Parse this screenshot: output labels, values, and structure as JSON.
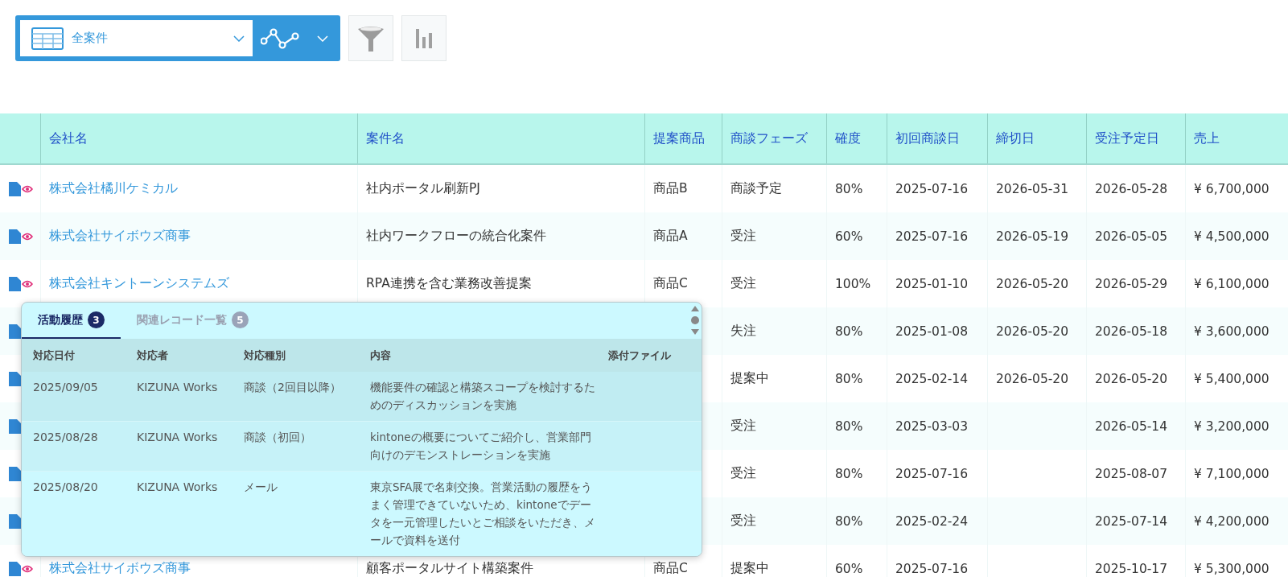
{
  "toolbar": {
    "view_name": "全案件"
  },
  "table": {
    "columns": [
      "会社名",
      "案件名",
      "提案商品",
      "商談フェーズ",
      "確度",
      "初回商談日",
      "締切日",
      "受注予定日",
      "売上"
    ],
    "rows": [
      {
        "company": "株式会社橘川ケミカル",
        "deal": "社内ポータル刷新PJ",
        "product": "商品B",
        "phase": "商談予定",
        "probability": "80%",
        "first_meeting": "2025-07-16",
        "deadline": "2026-05-31",
        "order_date": "2026-05-28",
        "sales": "¥ 6,700,000"
      },
      {
        "company": "株式会社サイボウズ商事",
        "deal": "社内ワークフローの統合化案件",
        "product": "商品A",
        "phase": "受注",
        "probability": "60%",
        "first_meeting": "2025-07-16",
        "deadline": "2026-05-19",
        "order_date": "2026-05-05",
        "sales": "¥ 4,500,000"
      },
      {
        "company": "株式会社キントーンシステムズ",
        "deal": "RPA連携を含む業務改善提案",
        "product": "商品C",
        "phase": "受注",
        "probability": "100%",
        "first_meeting": "2025-01-10",
        "deadline": "2026-05-20",
        "order_date": "2026-05-29",
        "sales": "¥ 6,100,000"
      },
      {
        "phase": "失注",
        "probability": "80%",
        "first_meeting": "2025-01-08",
        "deadline": "2026-05-20",
        "order_date": "2026-05-18",
        "sales": "¥ 3,600,000"
      },
      {
        "phase": "提案中",
        "probability": "80%",
        "first_meeting": "2025-02-14",
        "deadline": "2026-05-20",
        "order_date": "2026-05-20",
        "sales": "¥ 5,400,000"
      },
      {
        "phase": "受注",
        "probability": "80%",
        "first_meeting": "2025-03-03",
        "order_date": "2026-05-14",
        "sales": "¥ 3,200,000"
      },
      {
        "phase": "受注",
        "probability": "80%",
        "first_meeting": "2025-07-16",
        "order_date": "2025-08-07",
        "sales": "¥ 7,100,000"
      },
      {
        "phase": "受注",
        "probability": "80%",
        "first_meeting": "2025-02-24",
        "order_date": "2025-07-14",
        "sales": "¥ 4,200,000"
      },
      {
        "company": "株式会社サイボウズ商事",
        "deal": "顧客ポータルサイト構築案件",
        "product": "商品C",
        "phase": "提案中",
        "probability": "60%",
        "first_meeting": "2025-07-16",
        "order_date": "2025-10-17",
        "sales": "¥ 5,300,000"
      }
    ]
  },
  "popup": {
    "tabs": [
      {
        "label": "活動履歴",
        "count": "3",
        "selected": true
      },
      {
        "label": "関連レコード一覧",
        "count": "5",
        "selected": false
      }
    ],
    "columns": [
      "対応日付",
      "対応者",
      "対応種別",
      "内容",
      "添付ファイル"
    ],
    "rows": [
      {
        "date": "2025/09/05",
        "person": "KIZUNA Works",
        "type": "商談（2回目以降）",
        "content": "機能要件の確認と構築スコープを検討するためのディスカッションを実施"
      },
      {
        "date": "2025/08/28",
        "person": "KIZUNA Works",
        "type": "商談（初回）",
        "content": "kintoneの概要についてご紹介し、営業部門向けのデモンストレーションを実施"
      },
      {
        "date": "2025/08/20",
        "person": "KIZUNA Works",
        "type": "メール",
        "content": "東京SFA展で名刺交換。営業活動の履歴をうまく管理できていないため、kintoneでデータを一元管理したいとご相談をいただき、メールで資料を送付"
      }
    ]
  }
}
